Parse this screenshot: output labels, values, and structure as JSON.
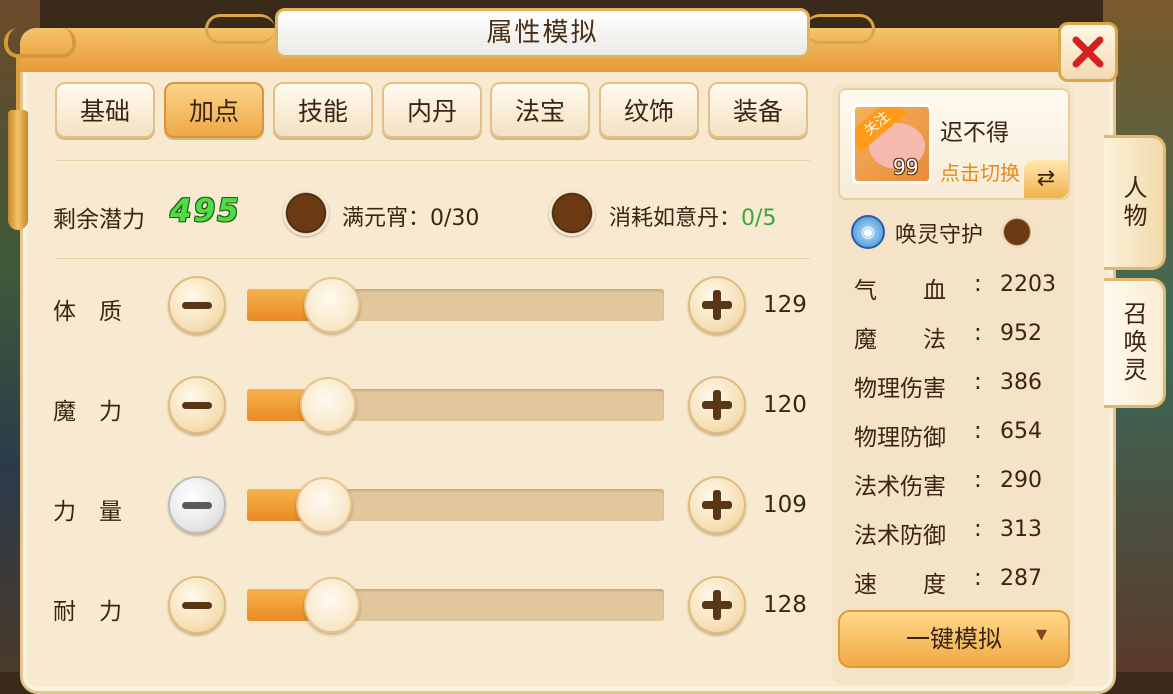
{
  "title": "属性模拟",
  "tabs": [
    {
      "label": "基础",
      "active": false
    },
    {
      "label": "加点",
      "active": true
    },
    {
      "label": "技能",
      "active": false
    },
    {
      "label": "内丹",
      "active": false
    },
    {
      "label": "法宝",
      "active": false
    },
    {
      "label": "纹饰",
      "active": false
    },
    {
      "label": "装备",
      "active": false
    }
  ],
  "potential": {
    "label": "剩余潜力",
    "value": "495"
  },
  "items": {
    "yuanxiao": {
      "label": "满元宵：",
      "value": "0/30"
    },
    "ruyidan": {
      "label": "消耗如意丹：",
      "value": "0/5"
    }
  },
  "attributes": [
    {
      "label": "体　质",
      "value": "129",
      "fill_fraction": 0.17,
      "minus_enabled": true
    },
    {
      "label": "魔　力",
      "value": "120",
      "fill_fraction": 0.16,
      "minus_enabled": true
    },
    {
      "label": "力　量",
      "value": "109",
      "fill_fraction": 0.15,
      "minus_enabled": false
    },
    {
      "label": "耐　力",
      "value": "128",
      "fill_fraction": 0.17,
      "minus_enabled": true
    }
  ],
  "pet": {
    "badge": "关注",
    "level": "99",
    "name": "迟不得",
    "switch_label": "点击切换",
    "switch_icon": "⇄"
  },
  "guard": {
    "label": "唤灵守护"
  },
  "stats": [
    {
      "name": "气　　血",
      "value": "2203"
    },
    {
      "name": "魔　　法",
      "value": "952"
    },
    {
      "name": "物理伤害",
      "value": "386"
    },
    {
      "name": "物理防御",
      "value": "654"
    },
    {
      "name": "法术伤害",
      "value": "290"
    },
    {
      "name": "法术防御",
      "value": "313"
    },
    {
      "name": "速　　度",
      "value": "287"
    }
  ],
  "simulate_button": "一键模拟",
  "side_tabs": [
    {
      "label": "人物",
      "active": false
    },
    {
      "label": "召唤灵",
      "active": true
    }
  ],
  "colors": {
    "potential_green": "#4fdc44",
    "accent_orange": "#e98a25",
    "close_red": "#d42020"
  }
}
